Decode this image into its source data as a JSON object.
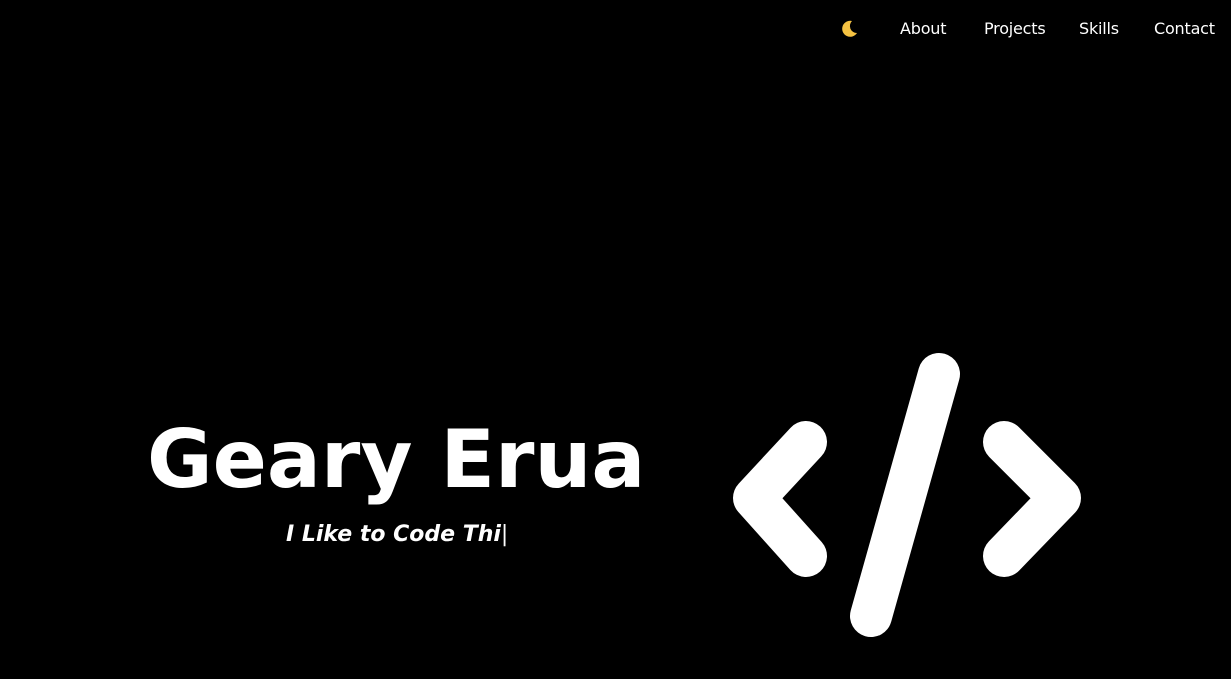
{
  "nav": {
    "theme_icon": "moon-icon",
    "items": [
      {
        "label": "About"
      },
      {
        "label": "Projects"
      },
      {
        "label": "Skills"
      },
      {
        "label": "Contact"
      }
    ]
  },
  "hero": {
    "name": "Geary Erua",
    "tagline_typed": "I Like to Code Thi",
    "cursor": "|",
    "logo_icon": "code-brackets-icon"
  },
  "colors": {
    "background": "#000000",
    "text": "#ffffff",
    "moon": "#f5c242"
  }
}
